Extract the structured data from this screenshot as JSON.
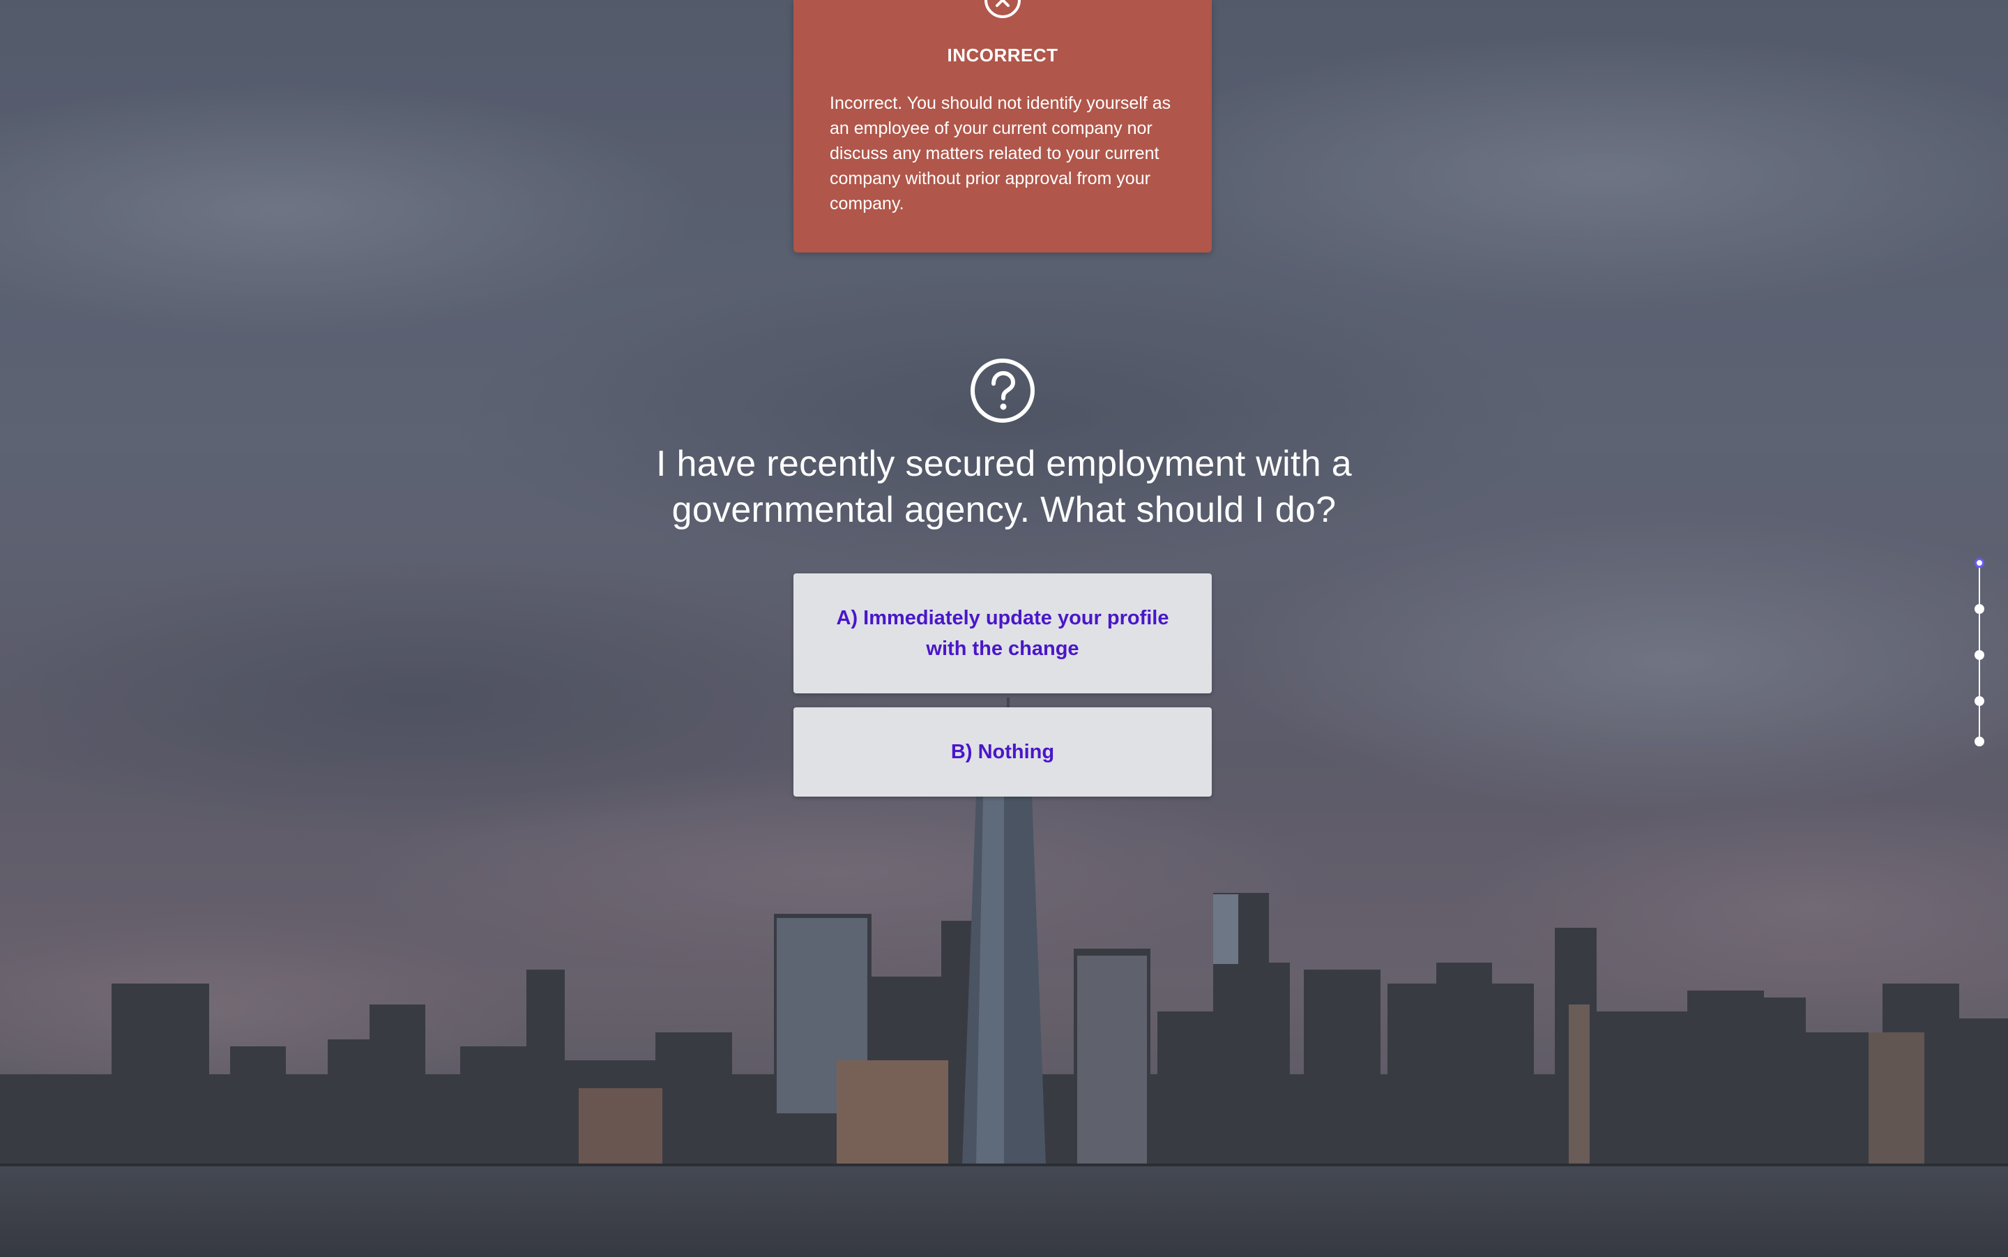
{
  "feedback": {
    "title": "INCORRECT",
    "body": "Incorrect. You should not identify yourself as an employee of your current company nor discuss any matters related to your current company without prior approval from your company.",
    "icon": "close-circle-icon",
    "color": "#b0564a"
  },
  "question": {
    "icon": "question-circle-icon",
    "text": "I have recently secured employment with a governmental agency. What should I do?"
  },
  "answers": [
    {
      "label": "A) Immediately update your profile with the change"
    },
    {
      "label": "B) Nothing"
    }
  ],
  "progress": {
    "total": 5,
    "current": 1
  },
  "colors": {
    "answer_text": "#4a16c9",
    "answer_bg": "#dfe1e5",
    "progress_active": "#6a5cf0"
  }
}
